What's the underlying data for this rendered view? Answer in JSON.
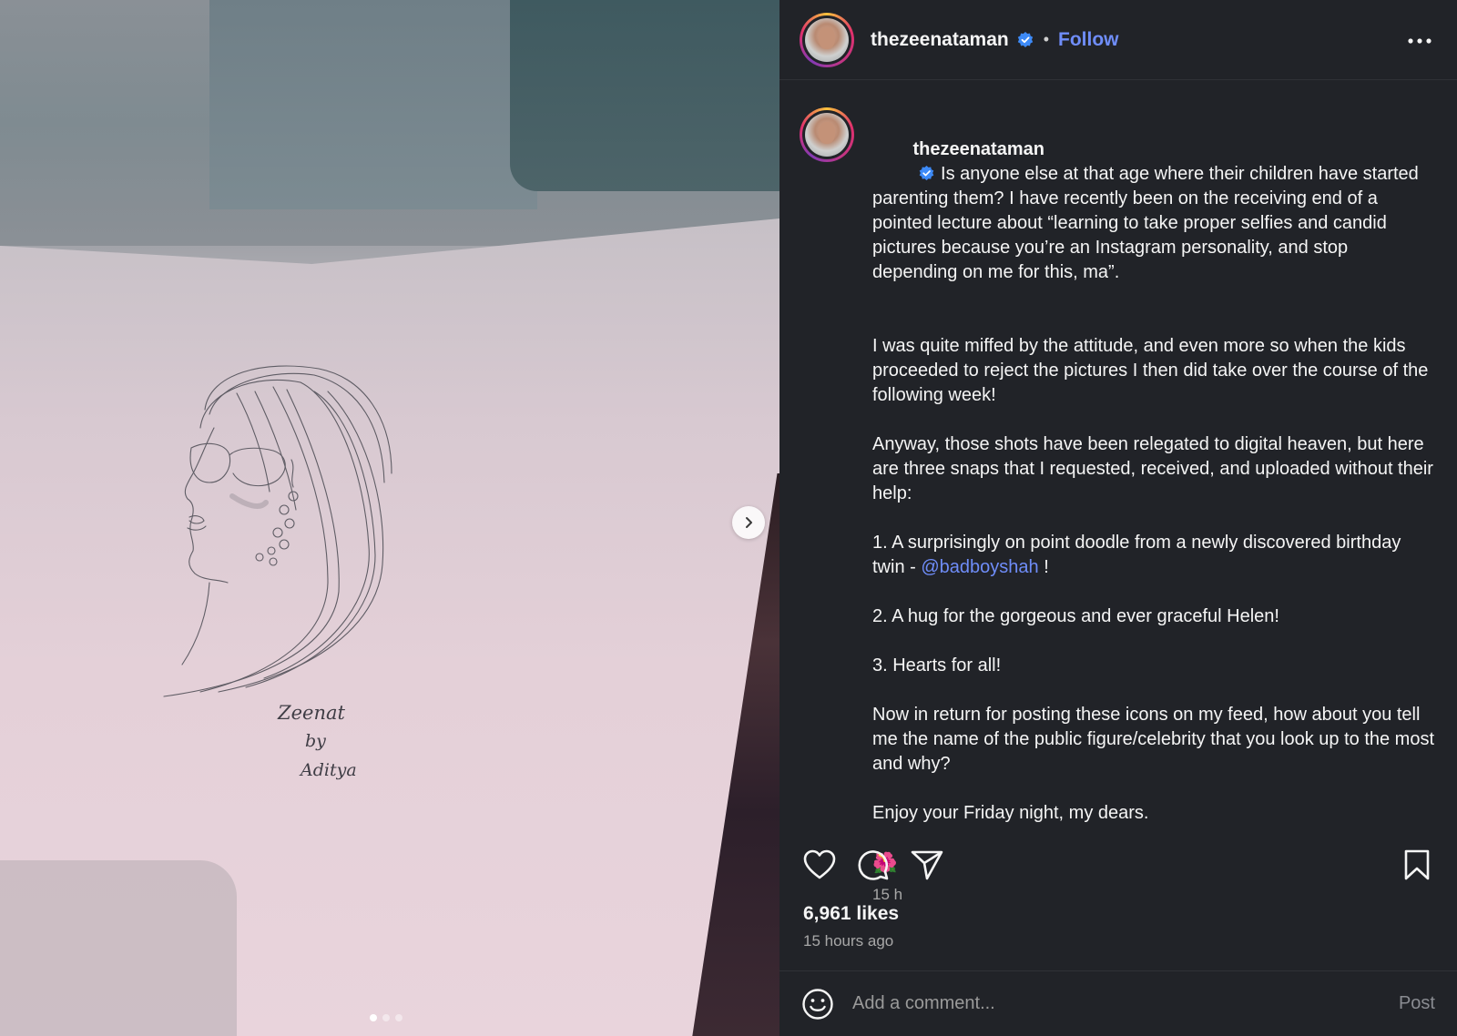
{
  "post": {
    "username": "thezeenataman",
    "separator": "•",
    "follow_label": "Follow",
    "caption": {
      "lead": " Is anyone else at that age where their children have started parenting them? I have recently been on the receiving end of a pointed lecture about “learning to take proper selfies and candid pictures because you’re an Instagram personality, and stop depending on me for this, ma”.",
      "p2": "I was quite miffed by the attitude, and even more so when the kids proceeded to reject the pictures I then did take over the course of the following week!",
      "p3": "Anyway, those shots have been relegated to digital heaven, but here are three snaps that I requested, received, and uploaded without their help:",
      "p4_pre": "1. A surprisingly on point doodle from a newly discovered birthday twin - ",
      "p4_mention": "@badboyshah",
      "p4_post": " !",
      "p5": "2. A hug for the gorgeous and ever graceful Helen!",
      "p6": "3. Hearts for all!",
      "p7": "Now in return for posting these icons on my feed, how about you tell me the name of the public figure/celebrity that you look up to the most and why?",
      "p8": "Enjoy your Friday night, my dears.",
      "emoji": "🌺",
      "time": "15 h"
    },
    "likes": "6,961 likes",
    "posted_ago": "15 hours ago",
    "comment": {
      "placeholder": "Add a comment...",
      "post_label": "Post"
    },
    "carousel": {
      "slide_count": 3,
      "active_index": 0
    },
    "sketch_signature": [
      "Zeenat",
      "by",
      "Aditya"
    ]
  },
  "icons": {
    "verified": "verified-badge-icon",
    "more": "more-options-icon",
    "like": "heart-icon",
    "comment": "comment-bubble-icon",
    "share": "paper-plane-icon",
    "save": "bookmark-icon",
    "emoji": "smiley-icon",
    "next": "chevron-right-icon"
  },
  "colors": {
    "panel_bg": "#212328",
    "link": "#6f8df9",
    "verified": "#3d8af7"
  }
}
